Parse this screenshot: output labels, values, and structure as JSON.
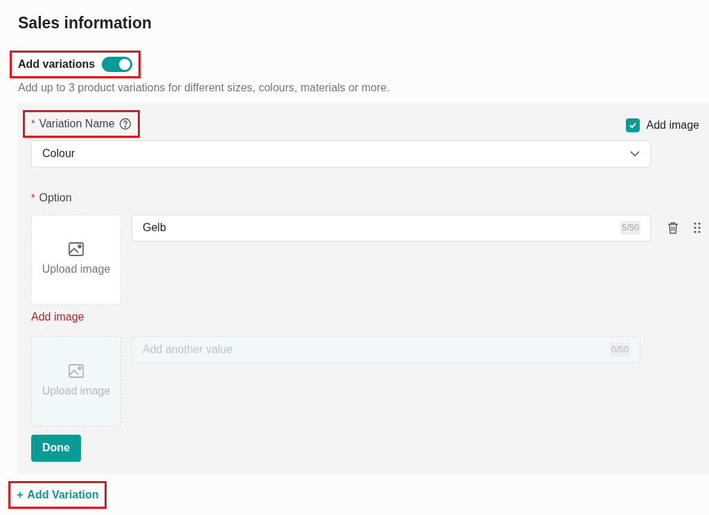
{
  "section_title": "Sales information",
  "variations_toggle": {
    "label": "Add variations",
    "on": true,
    "highlighted": true
  },
  "description": "Add up to 3 product variations for different sizes, colours, materials or more.",
  "variation": {
    "name_label": {
      "required_mark": "*",
      "text": "Variation Name",
      "highlighted": true
    },
    "add_image": {
      "label": "Add image",
      "checked": true
    },
    "name_value": "Colour",
    "option_label": {
      "required_mark": "*",
      "text": "Option"
    },
    "options": [
      {
        "kind": "filled",
        "upload_label": "Upload image",
        "value": "Gelb",
        "counter": "5/50",
        "error": "Add image"
      },
      {
        "kind": "empty",
        "upload_label": "Upload image",
        "placeholder": "Add another value",
        "counter": "0/50"
      }
    ],
    "done_button": "Done"
  },
  "add_variation": {
    "icon": "+",
    "label": "Add Variation",
    "highlighted": true
  }
}
